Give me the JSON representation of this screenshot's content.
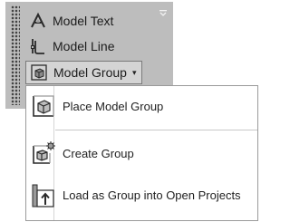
{
  "ribbon": {
    "tools": [
      {
        "label": "Model Text",
        "icon": "model-text-icon"
      },
      {
        "label": "Model Line",
        "icon": "model-line-icon"
      },
      {
        "label": "Model Group",
        "icon": "model-group-icon",
        "has_dropdown": true,
        "active": true
      }
    ],
    "dropdown_arrow": "▾"
  },
  "menu": {
    "items": [
      {
        "label": "Place Model Group",
        "icon": "place-model-group-icon"
      },
      {
        "label": "Create Group",
        "icon": "create-group-icon"
      },
      {
        "label": "Load as Group into Open Projects",
        "icon": "load-as-group-icon"
      }
    ]
  }
}
